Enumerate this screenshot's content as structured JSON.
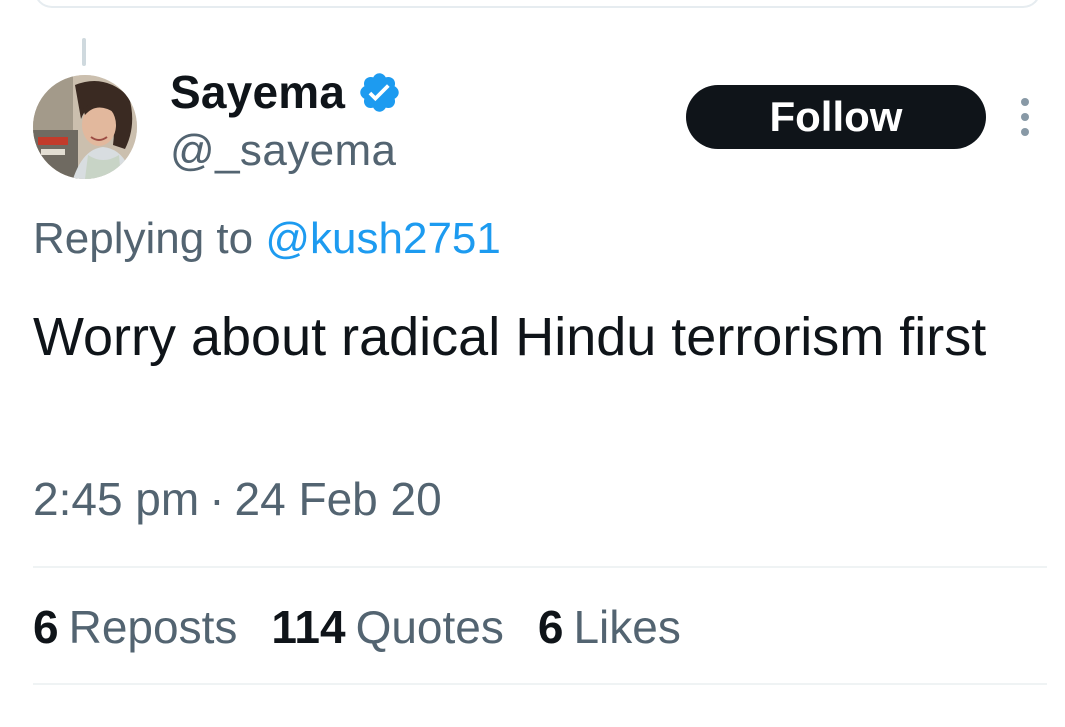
{
  "author": {
    "display_name": "Sayema",
    "handle": "@_sayema",
    "verified": true
  },
  "follow_button": {
    "label": "Follow"
  },
  "reply_context": {
    "prefix": "Replying to",
    "mention": "@kush2751"
  },
  "tweet": {
    "text": "Worry about radical Hindu terrorism first"
  },
  "timestamp": {
    "time": "2:45 pm",
    "separator": "·",
    "date": "24 Feb 20"
  },
  "stats": {
    "reposts": {
      "count": "6",
      "label": "Reposts"
    },
    "quotes": {
      "count": "114",
      "label": "Quotes"
    },
    "likes": {
      "count": "6",
      "label": "Likes"
    }
  },
  "icons": {
    "verified": "verified-badge-icon",
    "more": "more-options-icon"
  },
  "colors": {
    "text_primary": "#0f1419",
    "text_secondary": "#536471",
    "link": "#1d9bf0",
    "verified_badge": "#1d9bf0",
    "follow_button_bg": "#0f1419",
    "follow_button_text": "#ffffff",
    "divider": "#eff3f4"
  }
}
